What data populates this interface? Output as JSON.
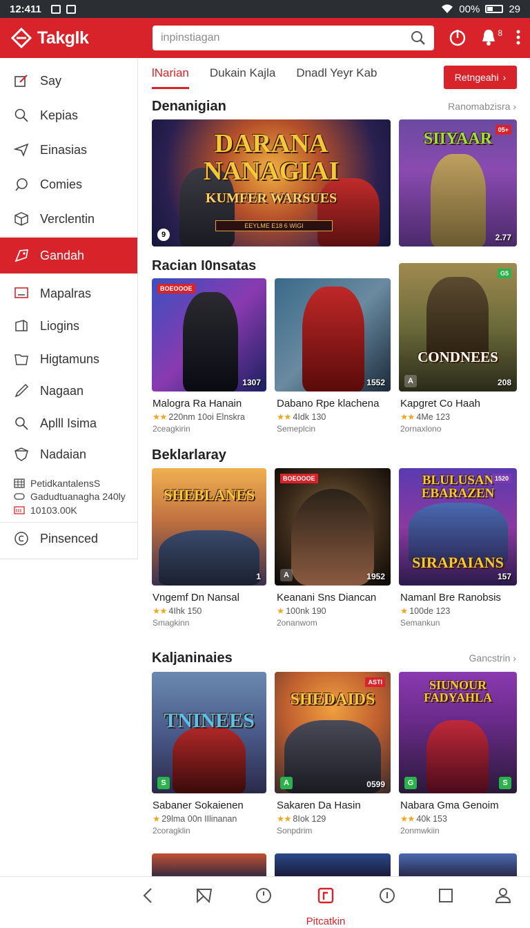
{
  "status_bar": {
    "time": "12:411",
    "battery": "00%",
    "extra": "29"
  },
  "header": {
    "title": "Takglk",
    "search_placeholder": "inpinstiagan",
    "notification_count": "8"
  },
  "sidebar": {
    "items": [
      {
        "label": "Say",
        "icon": "edit-square-icon"
      },
      {
        "label": "Kepias",
        "icon": "search-icon"
      },
      {
        "label": "Einasias",
        "icon": "send-icon"
      },
      {
        "label": "Comies",
        "icon": "chat-icon"
      },
      {
        "label": "Verclentin",
        "icon": "cube-icon"
      },
      {
        "label": "Gandah",
        "icon": "tag-icon"
      },
      {
        "label": "Mapalras",
        "icon": "monitor-icon"
      },
      {
        "label": "Liogins",
        "icon": "box-icon"
      },
      {
        "label": "Higtamuns",
        "icon": "folder-icon"
      },
      {
        "label": "Nagaan",
        "icon": "pen-icon"
      },
      {
        "label": "Aplll Isima",
        "icon": "magnifier-icon"
      },
      {
        "label": "Nadaian",
        "icon": "shield-icon"
      }
    ],
    "mini": [
      {
        "label": "PetidkantalensS",
        "icon": "grid-icon"
      },
      {
        "label": "Gadudtuanagha 240ly",
        "icon": "pill-icon"
      },
      {
        "label": "10103.00K",
        "icon": "card-icon"
      }
    ],
    "footer_item": {
      "label": "Pinsenced",
      "icon": "circle-c-icon"
    }
  },
  "tabs": [
    {
      "label": "lNarian",
      "active": true
    },
    {
      "label": "Dukain Kajla",
      "active": false
    },
    {
      "label": "Dnadl Yeyr Kab",
      "active": false
    }
  ],
  "cta_label": "Retngeahi",
  "sections": {
    "featured": {
      "title": "Denanigian",
      "more": "Ranomabzisra",
      "main_banner": {
        "title_line1": "DARANA",
        "title_line2": "NANAGIAI",
        "subtitle": "KUMFER WARSUES",
        "strip": "EEYLME E18 6 WIGI",
        "badge": "9"
      },
      "side_banner": {
        "title": "SIIYAAR",
        "tag": "05+",
        "badge": "2.77"
      }
    },
    "recent": {
      "title": "Racian I0nsatas",
      "items": [
        {
          "name": "Malogra Ra Hanain",
          "stars": "★★",
          "rating": "220nm 10oi Elnskra",
          "sub": "2ceagkirin",
          "badge": "1307",
          "tag": "BOEOOOE",
          "art_title": ""
        },
        {
          "name": "Dabano Rpe klachena",
          "stars": "★★",
          "rating": "4Idk 130",
          "sub": "Semeplcin",
          "badge": "1552",
          "tag": "",
          "art_title": ""
        },
        {
          "name": "Kapgret Co Haah",
          "stars": "★★",
          "rating": "4Me 123",
          "sub": "2ornaxlono",
          "badge": "208",
          "tag": "G5",
          "art_title": "CONDNEES"
        }
      ]
    },
    "popular": {
      "title": "Beklarlaray",
      "items": [
        {
          "name": "Vngemf Dn Nansal",
          "stars": "★★",
          "rating": "4Ihk 150",
          "sub": "Smagkinn",
          "badge": "1",
          "tag": "",
          "art_title": "SHEBLANES"
        },
        {
          "name": "Keanani Sns Diancan",
          "stars": "★",
          "rating": "100nk 190",
          "sub": "2onanwom",
          "badge": "1952",
          "tag": "BOEOOOE",
          "art_title": ""
        },
        {
          "name": "Namanl Bre Ranobsis",
          "stars": "★",
          "rating": "100de 123",
          "sub": "Semankun",
          "badge": "157",
          "tag": "1520",
          "art_title": "BLULUSAN EBARAZEN"
        }
      ]
    },
    "categories": {
      "title": "Kaljaninaies",
      "more": "Gancstrin",
      "items": [
        {
          "name": "Sabaner Sokaienen",
          "stars": "★",
          "rating": "29lma 00n IIlinanan",
          "sub": "2coragklin",
          "badge": "",
          "tag": "",
          "art_title": "TNINEES"
        },
        {
          "name": "Sakaren Da Hasin",
          "stars": "★★",
          "rating": "8Iok 129",
          "sub": "Sonpdrim",
          "badge": "0599",
          "tag": "ASTI",
          "art_title": "SHEDAIDS"
        },
        {
          "name": "Nabara Gma Genoim",
          "stars": "★★",
          "rating": "40k 153",
          "sub": "2onmwkiin",
          "badge": "S",
          "tag": "",
          "art_title": "SIUNOUR FADYAHLA"
        }
      ]
    }
  },
  "bottom_nav": {
    "items": [
      {
        "icon": "back-icon"
      },
      {
        "icon": "send-icon"
      },
      {
        "icon": "clock-icon"
      },
      {
        "icon": "store-icon",
        "label": "Pitcatkin",
        "active": true
      },
      {
        "icon": "info-circle-icon"
      },
      {
        "icon": "square-icon"
      },
      {
        "icon": "profile-icon"
      }
    ]
  },
  "colors": {
    "accent": "#d9232a",
    "star": "#f0a71f",
    "badge_green": "#2bb24c"
  }
}
